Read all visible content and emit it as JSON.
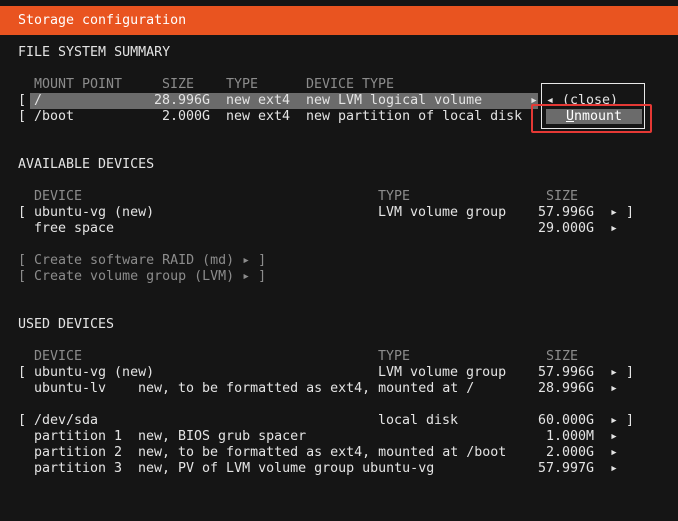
{
  "title": "Storage configuration",
  "fs_summary": {
    "heading": "FILE SYSTEM SUMMARY",
    "columns": [
      "MOUNT POINT",
      "SIZE",
      "TYPE",
      "DEVICE TYPE"
    ],
    "rows": [
      {
        "bracket": "[",
        "mount": "/",
        "size": "28.996G",
        "type": "new ext4",
        "device_type": "new LVM logical volume",
        "arrow": "▸"
      },
      {
        "bracket": "[",
        "mount": "/boot",
        "size": "2.000G",
        "type": "new ext4",
        "device_type": "new partition of local disk",
        "arrow": "▸"
      }
    ]
  },
  "context_menu": {
    "close_label": "◂ (close)",
    "unmount_first": "U",
    "unmount_rest": "nmount"
  },
  "available": {
    "heading": "AVAILABLE DEVICES",
    "columns": [
      "DEVICE",
      "TYPE",
      "SIZE"
    ],
    "rows": [
      {
        "bracket_open": "[",
        "device": "ubuntu-vg (new)",
        "type": "LVM volume group",
        "size": "57.996G",
        "arrow": "▸",
        "bracket_close": "]"
      },
      {
        "device": "free space",
        "size": "29.000G",
        "arrow": "▸"
      }
    ],
    "actions": [
      "[ Create software RAID (md) ▸ ]",
      "[ Create volume group (LVM) ▸ ]"
    ]
  },
  "used": {
    "heading": "USED DEVICES",
    "columns": [
      "DEVICE",
      "TYPE",
      "SIZE"
    ],
    "vg": {
      "bracket_open": "[",
      "device": "ubuntu-vg (new)",
      "type": "LVM volume group",
      "size": "57.996G",
      "arrow": "▸",
      "bracket_close": "]",
      "children": [
        {
          "device": "ubuntu-lv",
          "desc": "new, to be formatted as ext4, mounted at /",
          "size": "28.996G",
          "arrow": "▸"
        }
      ]
    },
    "disk": {
      "bracket_open": "[",
      "device": "/dev/sda",
      "type": "local disk",
      "size": "60.000G",
      "arrow": "▸",
      "bracket_close": "]",
      "children": [
        {
          "device": "partition 1",
          "desc": "new, BIOS grub spacer",
          "size": "1.000M",
          "arrow": "▸"
        },
        {
          "device": "partition 2",
          "desc": "new, to be formatted as ext4, mounted at /boot",
          "size": "2.000G",
          "arrow": "▸"
        },
        {
          "device": "partition 3",
          "desc": "new, PV of LVM volume group ubuntu-vg",
          "size": "57.997G",
          "arrow": "▸"
        }
      ]
    }
  }
}
